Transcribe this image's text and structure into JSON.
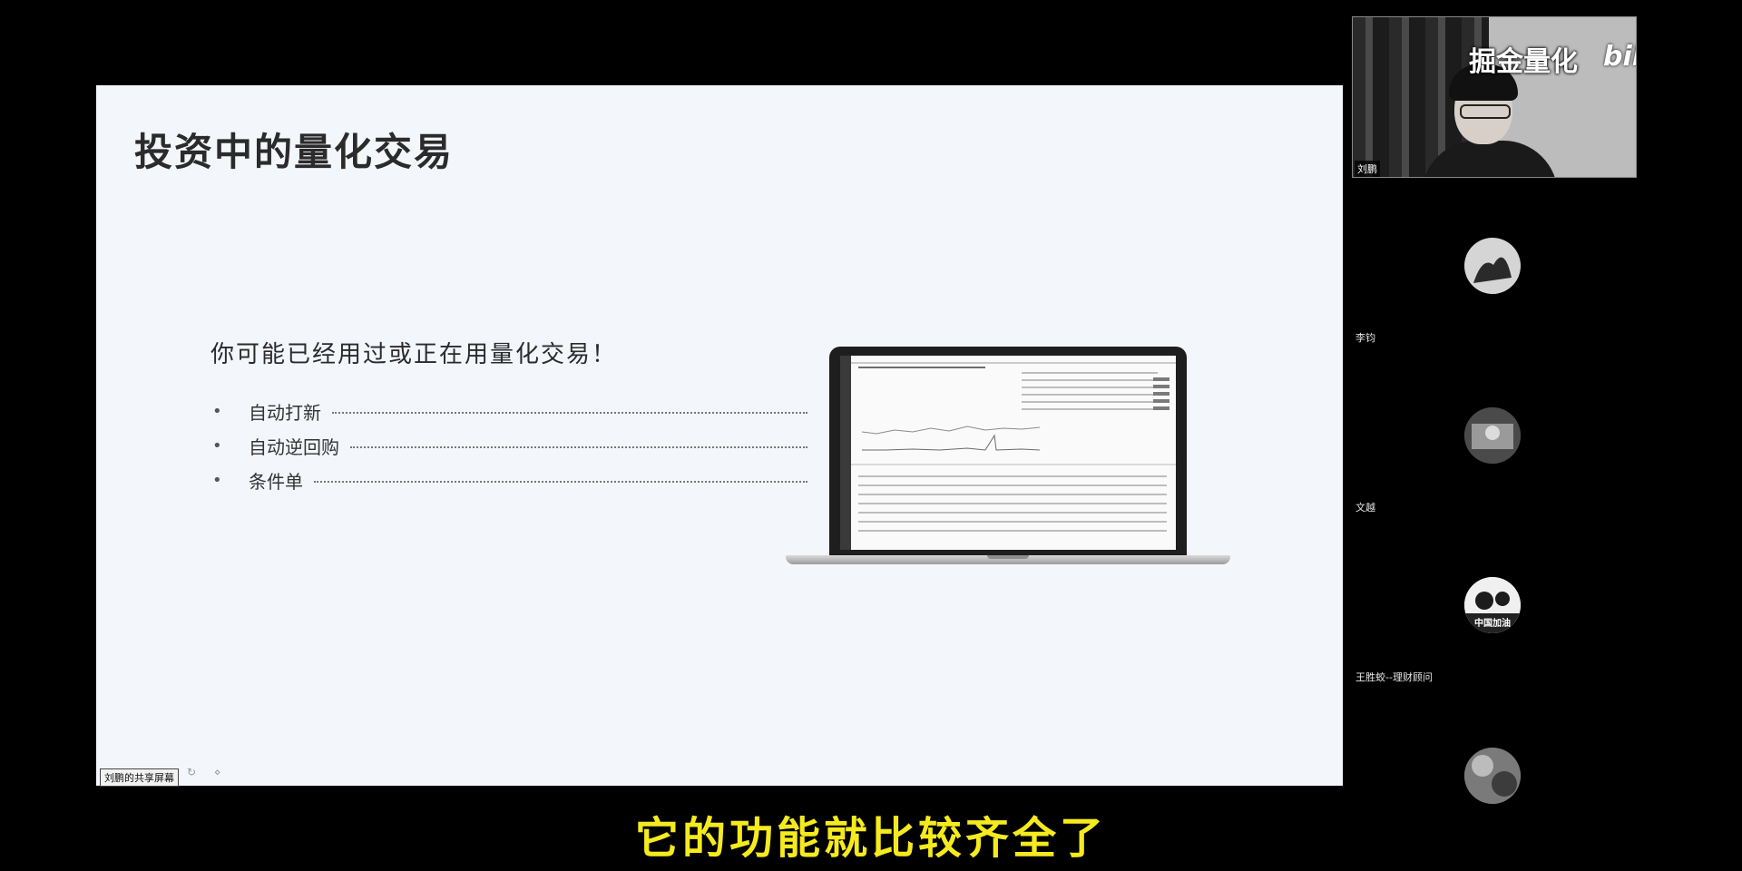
{
  "slide": {
    "title": "投资中的量化交易",
    "subtitle": "你可能已经用过或正在用量化交易！",
    "items": [
      {
        "bullet": "•",
        "label": "自动打新",
        "mark": "(√)"
      },
      {
        "bullet": "•",
        "label": "自动逆回购",
        "mark": "(√)"
      },
      {
        "bullet": "•",
        "label": "条件单",
        "mark": "(√)"
      }
    ]
  },
  "share_tag": "刘鹏的共享屏幕",
  "presenter": {
    "brand": "掘金量化",
    "logo": "bilibili",
    "name": "刘鹏"
  },
  "participants": [
    {
      "name": "李钧",
      "avatar_color": "#9a9a9a"
    },
    {
      "name": "文越",
      "avatar_color": "#5a5a5a"
    },
    {
      "name": "王胜蛟--理财顾问",
      "avatar_color": "#e0e0e0",
      "avatar_text": "中国加油"
    },
    {
      "name": "",
      "avatar_color": "#6e6e6e"
    }
  ],
  "caption": "它的功能就比较齐全了"
}
